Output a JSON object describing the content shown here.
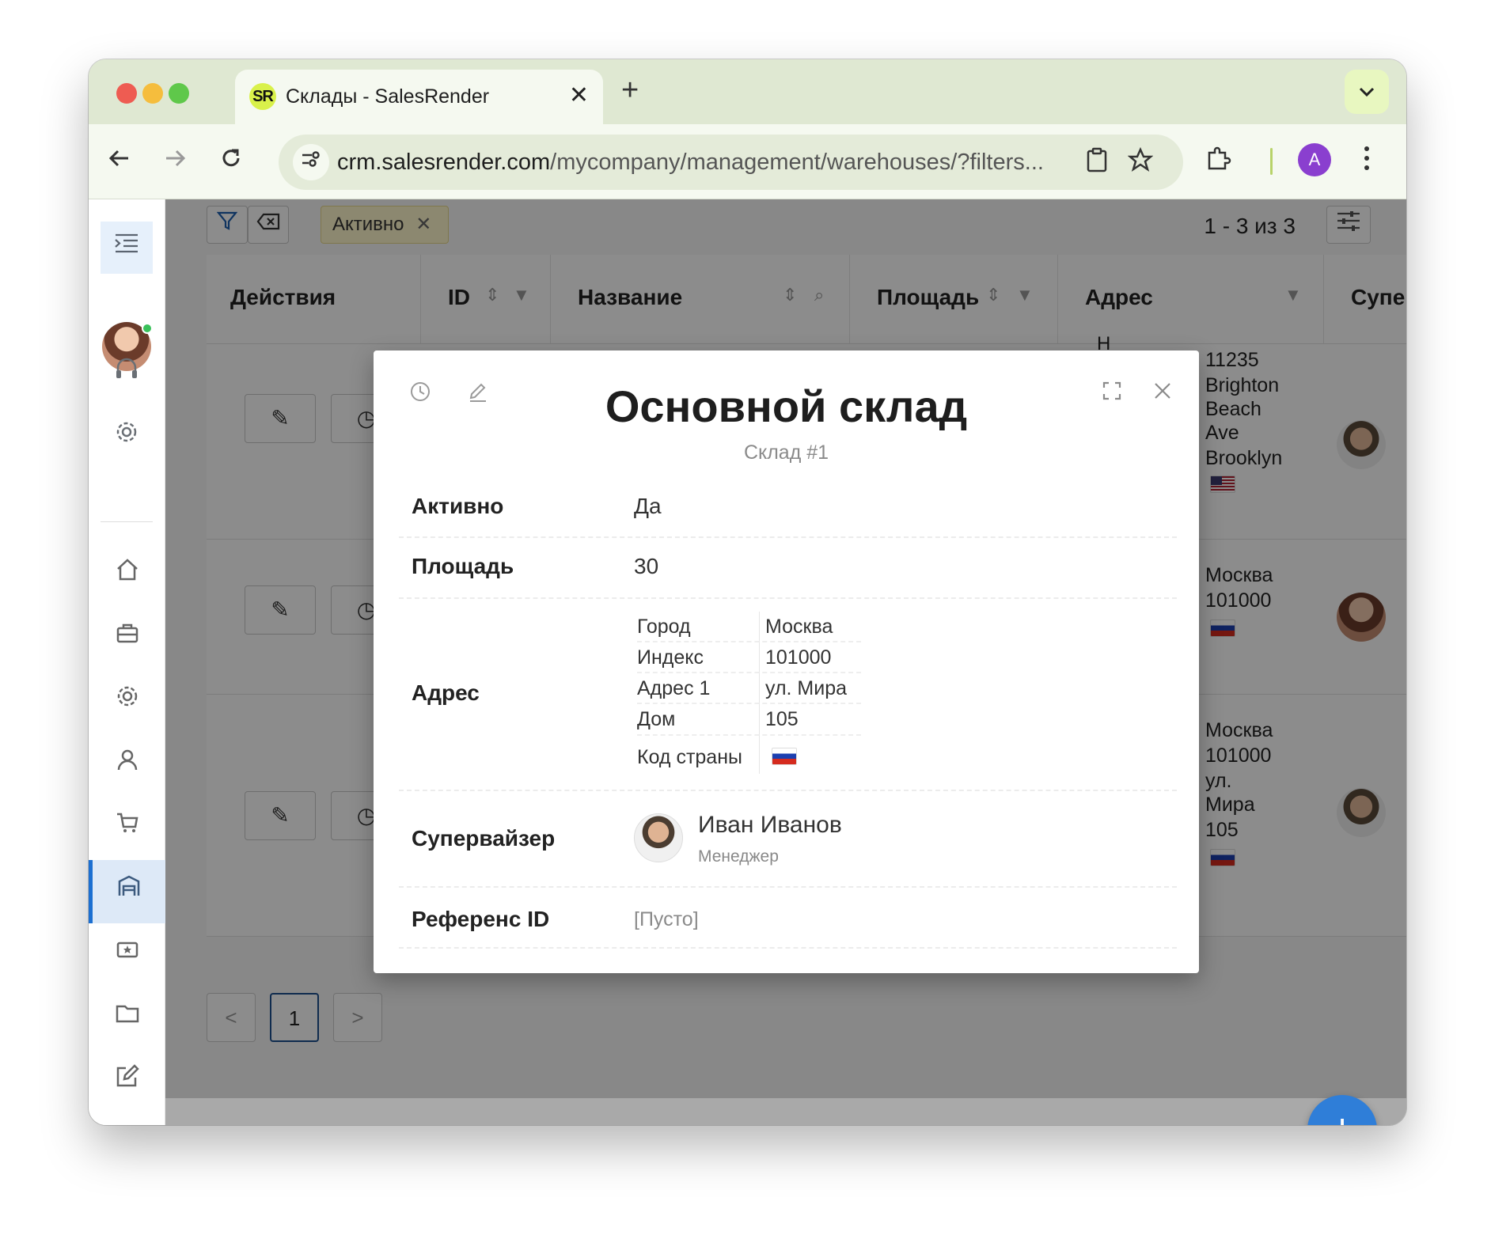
{
  "browser": {
    "tab_logo": "SR",
    "tab_title": "Склады - SalesRender",
    "tab_close": "✕",
    "new_tab": "+",
    "url_host": "crm.salesrender.com",
    "url_path": "/mycompany/management/warehouses/?filters...",
    "profile_initial": "A"
  },
  "toolbar": {
    "filter_chip": "Активно",
    "chip_close": "✕",
    "pagination_text": "1 - 3 из 3"
  },
  "grid": {
    "columns": [
      "Действия",
      "ID",
      "Название",
      "Площадь",
      "Адрес",
      "Супер"
    ],
    "rows": [
      {
        "address_lines": [
          "11235",
          "Brighton",
          "Beach",
          "Ave",
          "Brooklyn"
        ],
        "flag": "us"
      },
      {
        "address_lines": [
          "Москва",
          "101000"
        ],
        "flag": "ru"
      },
      {
        "address_lines": [
          "Москва",
          "101000",
          "ул.",
          "Мира",
          "105"
        ],
        "flag": "ru"
      }
    ],
    "row1_partial_text": "Н",
    "current_page": "1",
    "prev_page": "<",
    "next_page": ">"
  },
  "fab_label": "+",
  "modal": {
    "title": "Основной склад",
    "subtitle": "Склад #1",
    "fields": {
      "active_label": "Активно",
      "active_value": "Да",
      "area_label": "Площадь",
      "area_value": "30",
      "address_label": "Адрес",
      "supervisor_label": "Супервайзер",
      "reference_label": "Референс ID",
      "reference_value": "[Пусто]"
    },
    "address": [
      {
        "key": "Город",
        "value": "Москва"
      },
      {
        "key": "Индекс",
        "value": "101000"
      },
      {
        "key": "Адрес 1",
        "value": "ул. Мира"
      },
      {
        "key": "Дом",
        "value": "105"
      }
    ],
    "country_code_label": "Код страны",
    "supervisor": {
      "name": "Иван Иванов",
      "role": "Менеджер"
    }
  },
  "colors": {
    "accent": "#1c6fd1",
    "fab": "#2f7ed8",
    "chip_bg": "#fff7cc",
    "tab_strip": "#dfe8d2"
  },
  "icons": [
    "history-icon",
    "edit-icon",
    "expand-icon",
    "close-icon",
    "filter-icon",
    "clear-filter-icon",
    "sort-icon",
    "search-icon",
    "sliders-icon",
    "menu-icon",
    "headset-icon",
    "gear-icon",
    "home-icon",
    "briefcase-icon",
    "user-icon",
    "cart-icon",
    "warehouse-icon",
    "ticket-icon",
    "folder-icon",
    "note-icon"
  ]
}
